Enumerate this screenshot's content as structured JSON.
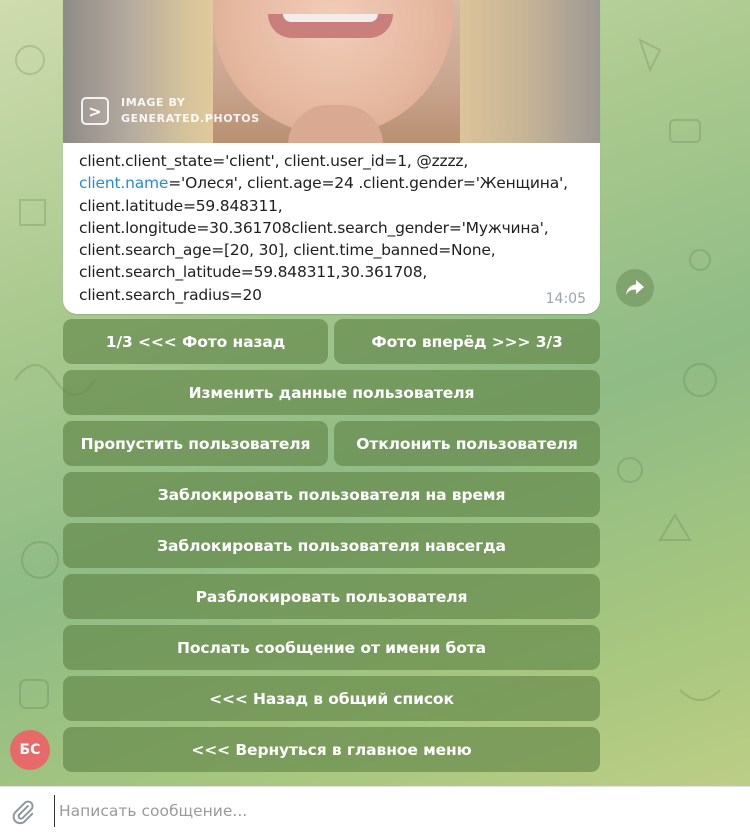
{
  "message": {
    "photo_watermark_line1": "IMAGE BY",
    "photo_watermark_line2": "GENERATED.PHOTOS",
    "photo_watermark_logo": ">",
    "text_before_link": "client.client_state='client', client.user_id=1, @zzzz, ",
    "link_text": "client.name",
    "text_after_link": "='Олеся', client.age=24 .client.gender='Женщина', client.latitude=59.848311, client.longitude=30.361708client.search_gender='Мужчина', client.search_age=[20, 30], client.time_banned=None, client.search_latitude=59.848311,30.361708, client.search_radius=20",
    "time": "14:05"
  },
  "keyboard": {
    "prev_photo": "1/3 <<< Фото назад",
    "next_photo": "Фото вперёд >>> 3/3",
    "edit_user": "Изменить данные пользователя",
    "skip_user": "Пропустить пользователя",
    "reject_user": "Отклонить пользователя",
    "ban_temp": "Заблокировать пользователя на время",
    "ban_forever": "Заблокировать пользователя навсегда",
    "unban": "Разблокировать пользователя",
    "send_as_bot": "Послать сообщение от имени бота",
    "back_to_list": "<<< Назад в общий список",
    "main_menu": "<<< Вернуться в главное меню"
  },
  "avatar": {
    "initials": "БС",
    "color": "#e66a6a"
  },
  "composer": {
    "placeholder": "Написать сообщение..."
  },
  "colors": {
    "link": "#2a8bd1",
    "button_bg": "#5f8246",
    "time": "#9aa5ad"
  },
  "icons": {
    "forward": "share-arrow-icon",
    "attach": "paperclip-icon"
  }
}
